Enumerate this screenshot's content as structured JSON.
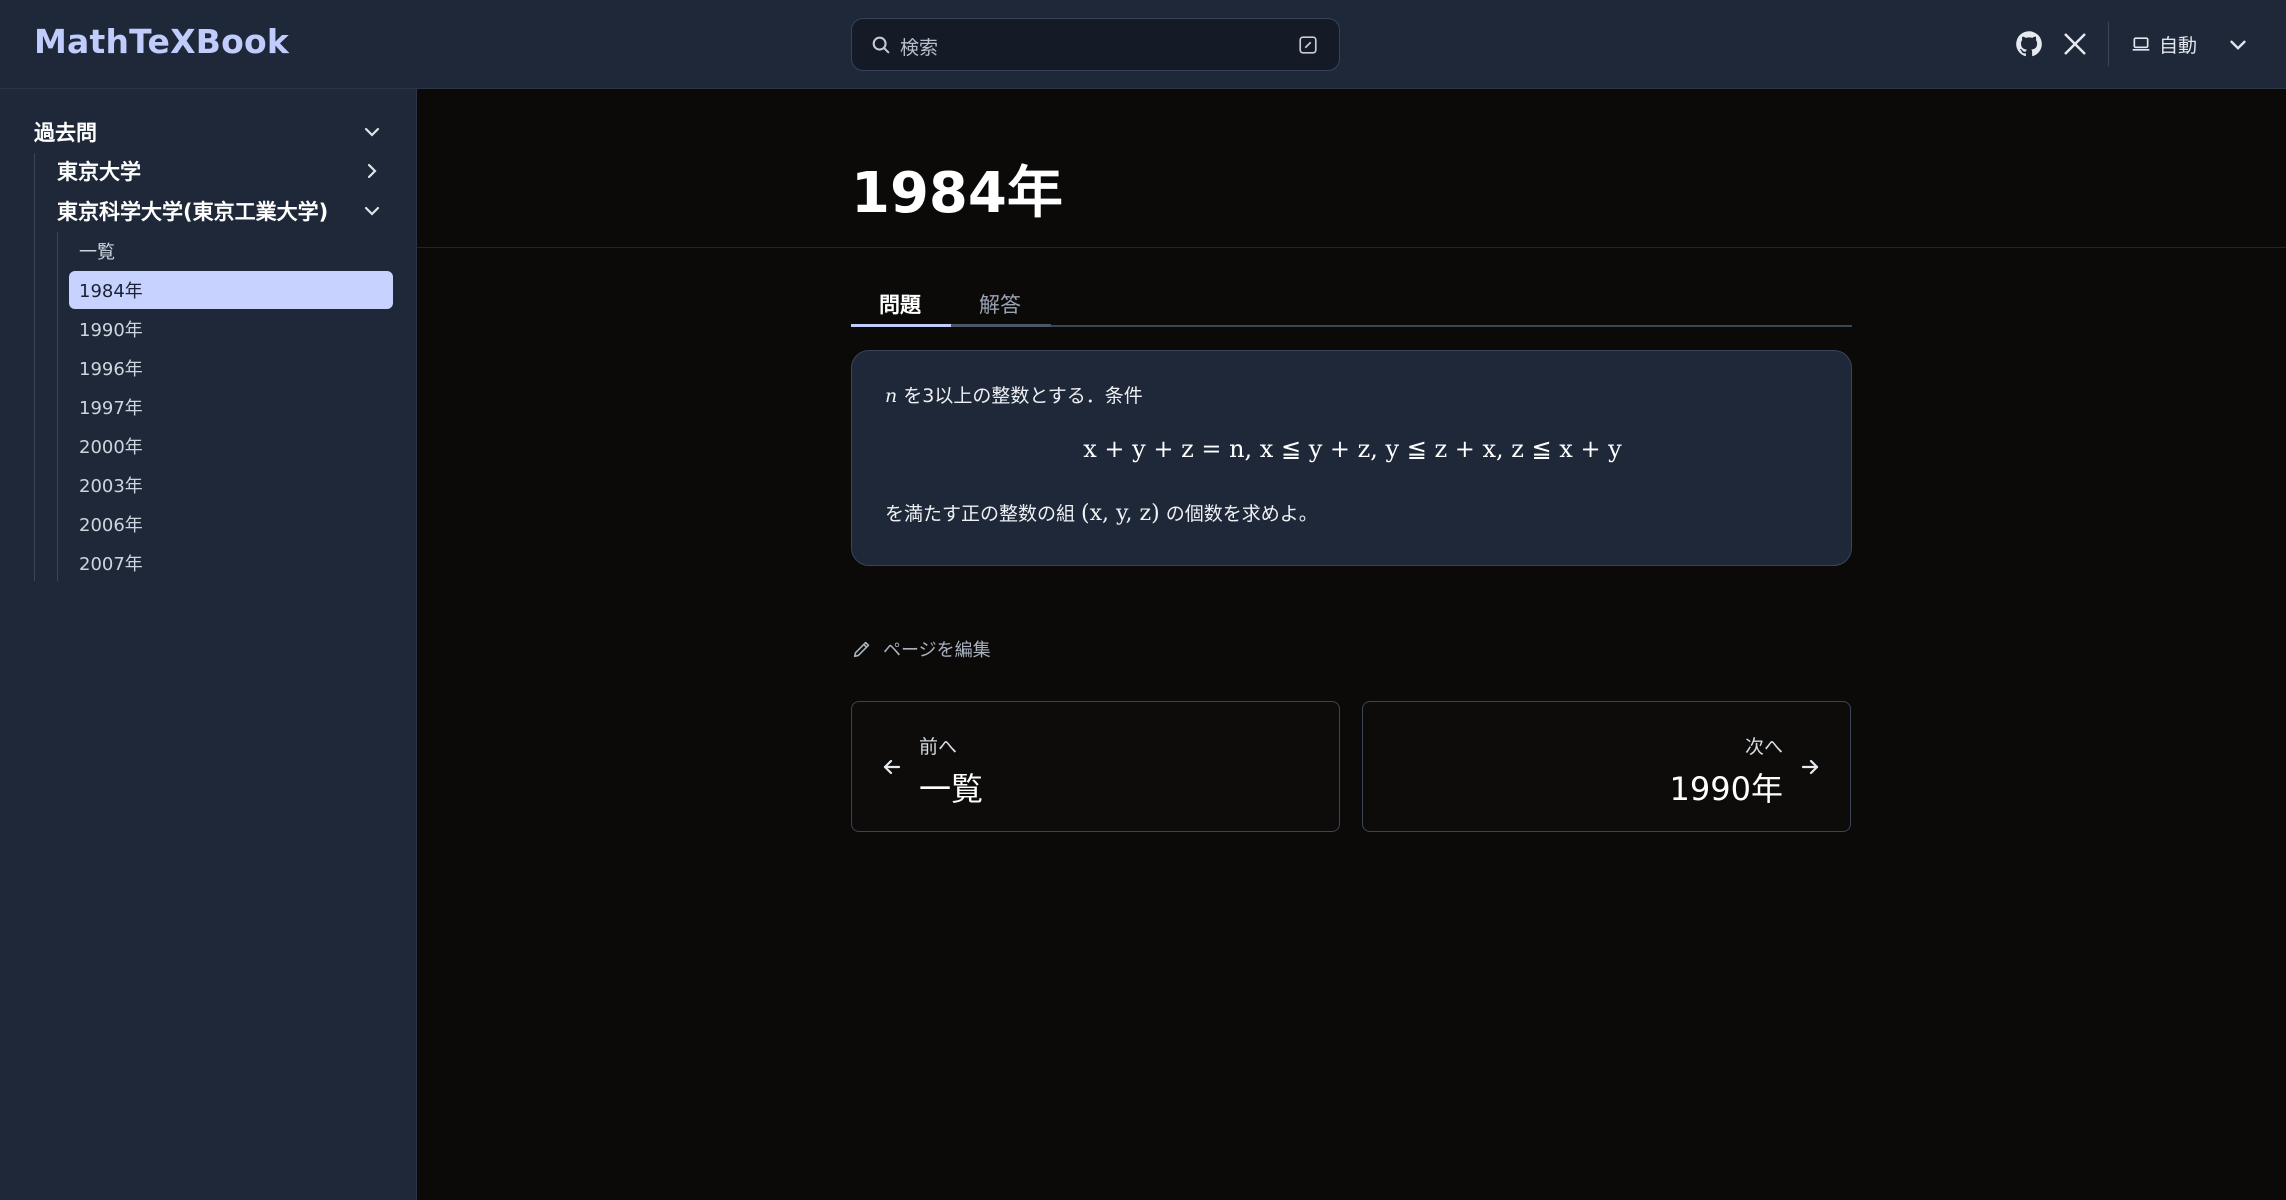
{
  "header": {
    "brand": "MathTeXBook",
    "search_placeholder": "検索",
    "theme_label": "自動",
    "icons": [
      "github-icon",
      "x-icon",
      "monitor-icon",
      "chevron-down-icon"
    ]
  },
  "sidebar": {
    "group_label": "過去問",
    "sub_groups": [
      {
        "label": "東京大学",
        "expanded": false
      },
      {
        "label": "東京科学大学(東京工業大学)",
        "expanded": true
      }
    ],
    "items": [
      {
        "label": "一覧"
      },
      {
        "label": "1984年",
        "active": true
      },
      {
        "label": "1990年"
      },
      {
        "label": "1996年"
      },
      {
        "label": "1997年"
      },
      {
        "label": "2000年"
      },
      {
        "label": "2003年"
      },
      {
        "label": "2006年"
      },
      {
        "label": "2007年"
      }
    ]
  },
  "main": {
    "title": "1984年",
    "tabs": [
      {
        "label": "問題",
        "active": true
      },
      {
        "label": "解答",
        "active": false
      }
    ],
    "problem": {
      "var_n": "n",
      "line1_rest": " を3以上の整数とする．条件",
      "math": "x + y + z = n, x ≦ y + z, y ≦ z + x, z ≦ x + y",
      "line2_before": "を満たす正の整数の組 ",
      "tuple": "(x, y, z)",
      "line2_after": " の個数を求めよ。"
    },
    "edit_label": "ページを編集",
    "nav": {
      "prev_small": "前へ",
      "prev_big": "一覧",
      "next_small": "次へ",
      "next_big": "1990年"
    }
  },
  "colors": {
    "header_bg": "#1f2838",
    "page_bg": "#0b0a09",
    "accent": "#c7d2fe",
    "brand": "#c0ccfb"
  }
}
